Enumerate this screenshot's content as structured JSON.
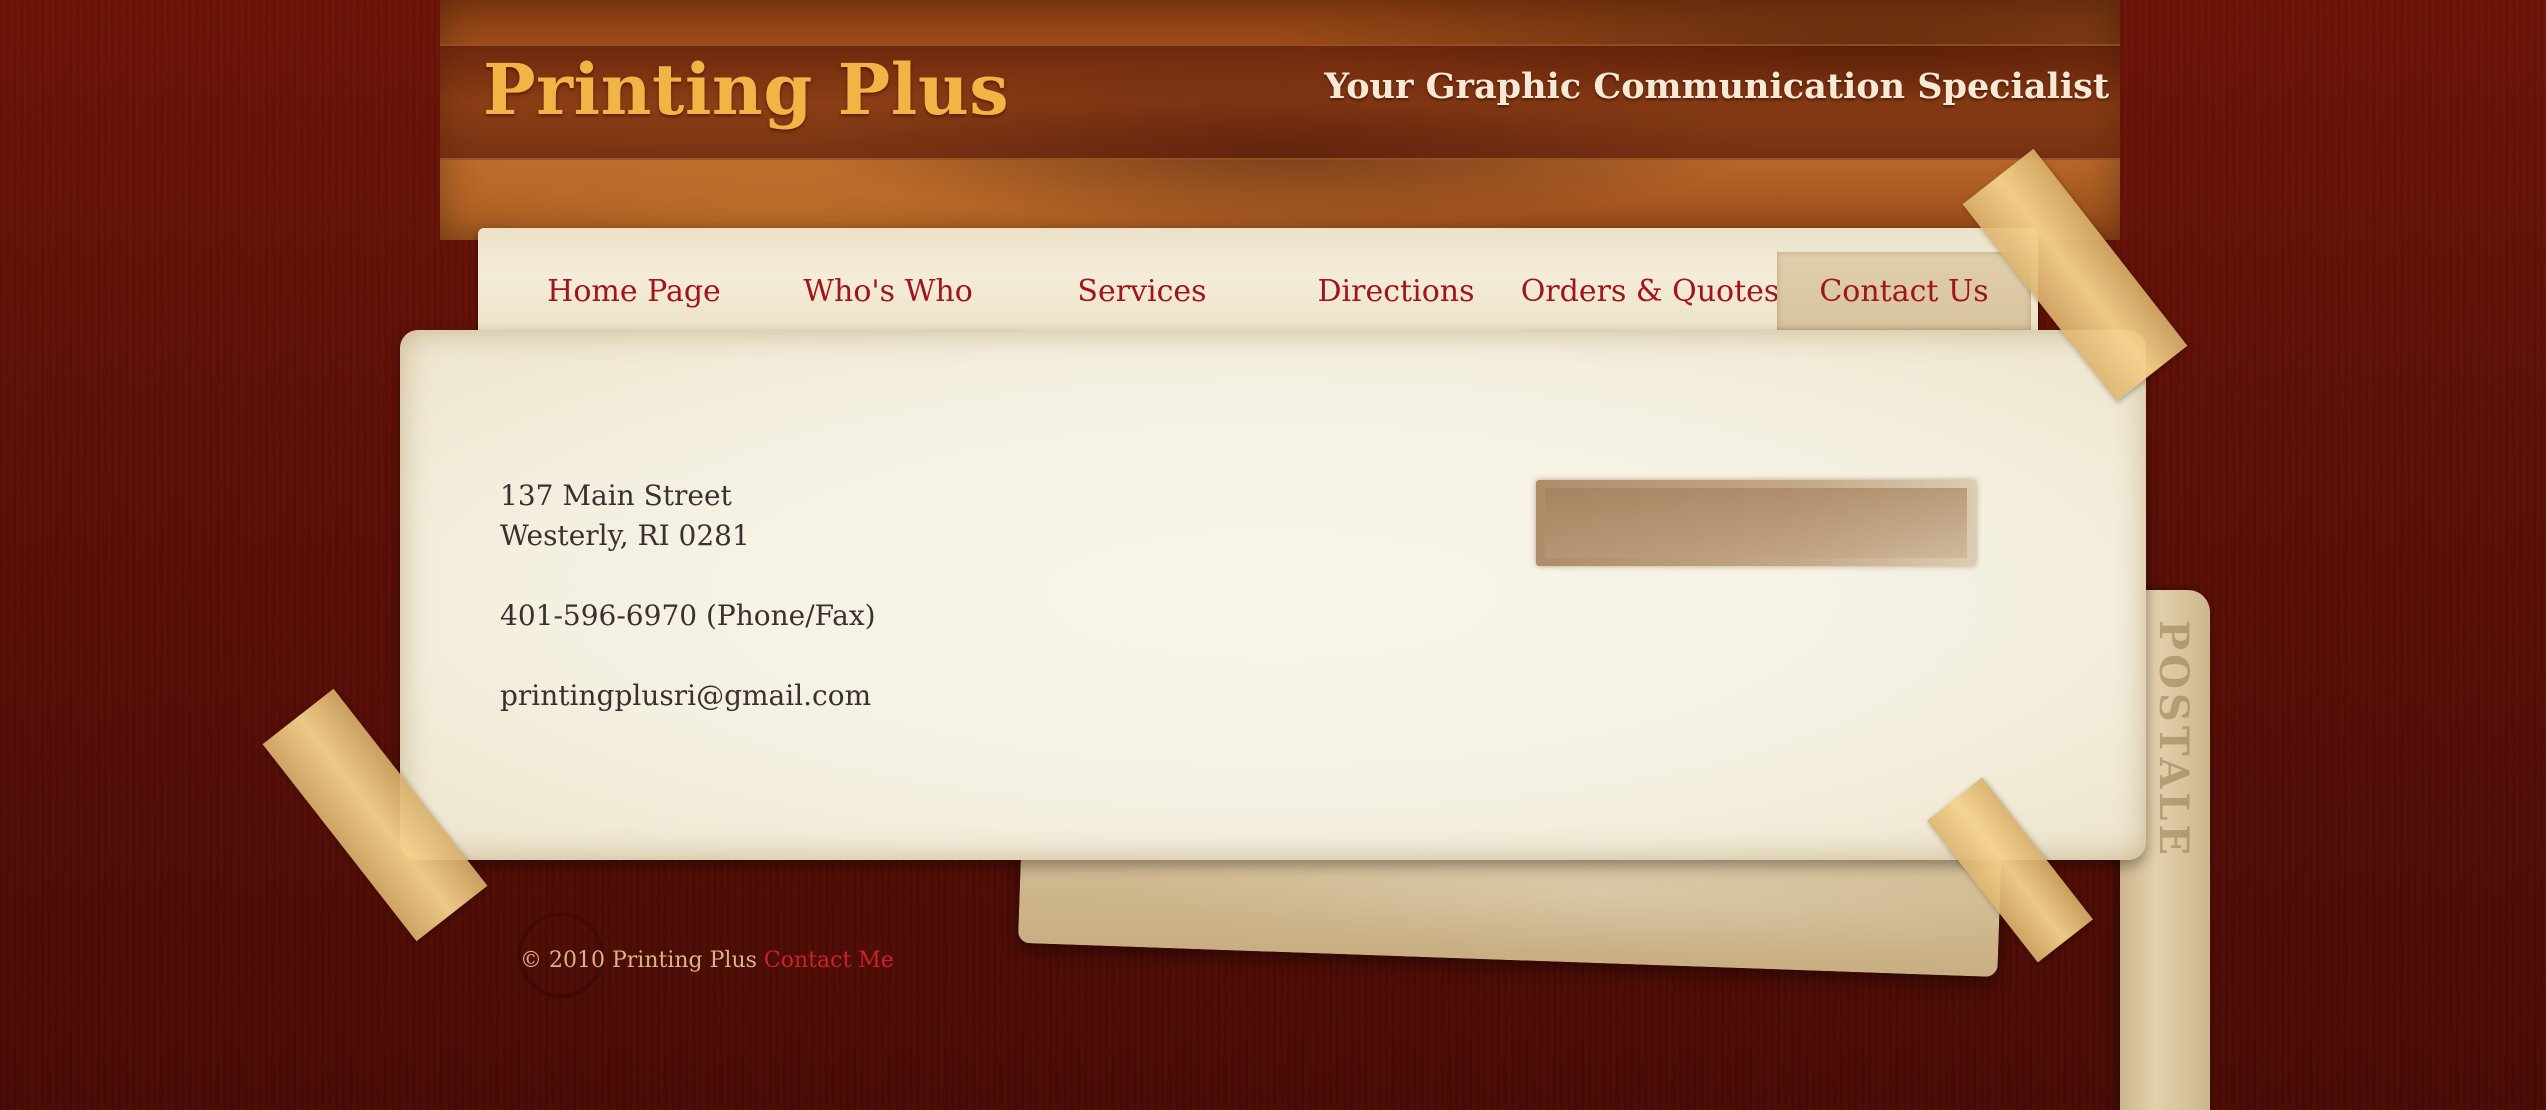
{
  "header": {
    "site_title": "Printing Plus",
    "tagline": "Your Graphic Communication Specialist"
  },
  "nav": {
    "items": [
      {
        "label": "Home Page",
        "active": false
      },
      {
        "label": "Who's Who",
        "active": false
      },
      {
        "label": "Services",
        "active": false
      },
      {
        "label": "Directions",
        "active": false
      },
      {
        "label": "Orders & Quotes",
        "active": false
      },
      {
        "label": "Contact Us",
        "active": true
      }
    ]
  },
  "contact": {
    "street": "137 Main Street",
    "city": "Westerly, RI 0281",
    "phone": "401-596-6970 (Phone/Fax)",
    "email": "printingplusri@gmail.com"
  },
  "decor": {
    "postcard_text": "POSTALE"
  },
  "footer": {
    "copyright": "© 2010 Printing Plus",
    "contact_link": "Contact Me"
  },
  "colors": {
    "background": "#5b0f07",
    "title_gold": "#f2b545",
    "nav_text": "#a0141a",
    "paper": "#f5f1e2",
    "footer_link": "#c8242a"
  }
}
